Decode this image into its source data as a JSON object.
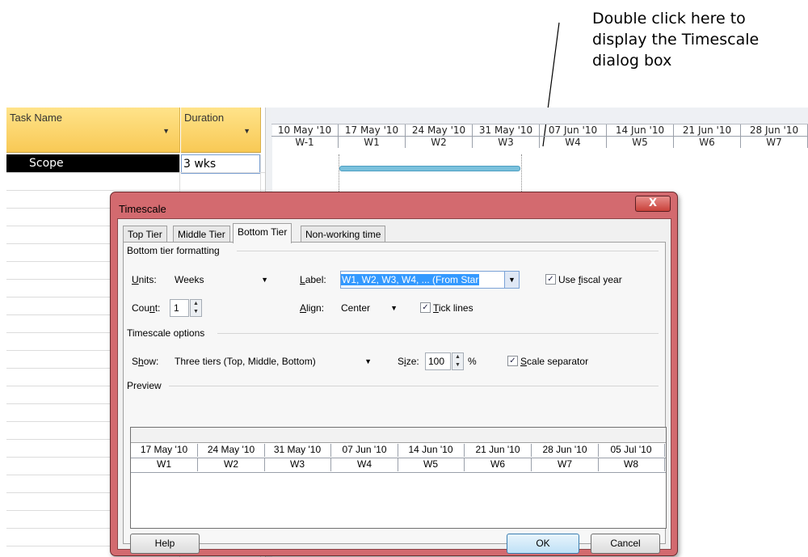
{
  "callout": {
    "text": "Double click here to display the Timescale dialog box"
  },
  "grid": {
    "headers": {
      "task_name": "Task Name",
      "duration": "Duration"
    },
    "rows": [
      {
        "task_name": "Scope",
        "duration": "3 wks"
      }
    ]
  },
  "timescale": {
    "middle": [
      "10 May '10",
      "17 May '10",
      "24 May '10",
      "31 May '10",
      "07 Jun '10",
      "14 Jun '10",
      "21 Jun '10",
      "28 Jun '10"
    ],
    "bottom": [
      "W-1",
      "W1",
      "W2",
      "W3",
      "W4",
      "W5",
      "W6",
      "W7"
    ]
  },
  "dialog": {
    "title": "Timescale",
    "close_label": "X",
    "tabs": [
      "Top Tier",
      "Middle Tier",
      "Bottom Tier",
      "Non-working time"
    ],
    "active_tab": "Bottom Tier",
    "bottom_tier_formatting": {
      "group_label": "Bottom tier formatting",
      "units_label": "Units:",
      "units_value": "Weeks",
      "label_label": "Label:",
      "label_value": "W1, W2, W3, W4, ... (From Star",
      "use_fiscal_year_label": "Use fiscal year",
      "use_fiscal_year_checked": true,
      "count_label": "Count:",
      "count_value": "1",
      "align_label": "Align:",
      "align_value": "Center",
      "tick_lines_label": "Tick lines",
      "tick_lines_checked": true
    },
    "timescale_options": {
      "group_label": "Timescale options",
      "show_label": "Show:",
      "show_value": "Three tiers (Top, Middle, Bottom)",
      "size_label": "Size:",
      "size_value": "100",
      "size_unit": "%",
      "scale_separator_label": "Scale separator",
      "scale_separator_checked": true
    },
    "preview": {
      "group_label": "Preview",
      "middle": [
        "17 May '10",
        "24 May '10",
        "31 May '10",
        "07 Jun '10",
        "14 Jun '10",
        "21 Jun '10",
        "28 Jun '10",
        "05 Jul '10"
      ],
      "bottom": [
        "W1",
        "W2",
        "W3",
        "W4",
        "W5",
        "W6",
        "W7",
        "W8"
      ]
    },
    "buttons": {
      "help": "Help",
      "ok": "OK",
      "cancel": "Cancel"
    }
  }
}
